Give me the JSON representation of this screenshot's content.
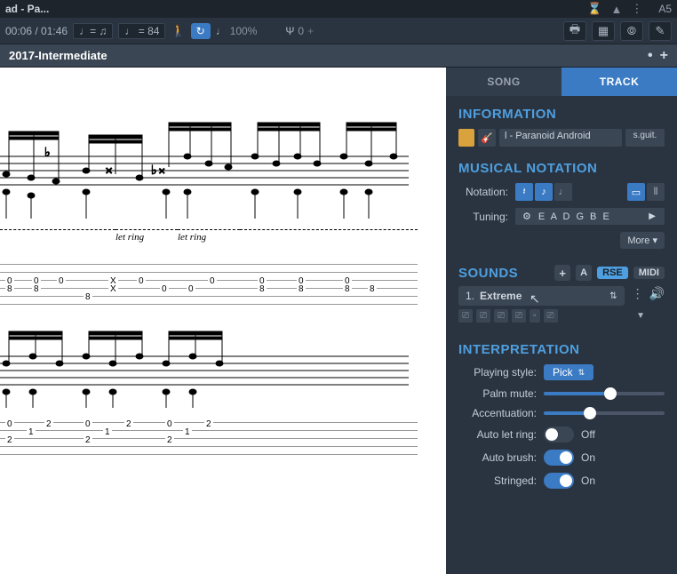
{
  "titlebar": {
    "title": "ad - Pa...",
    "right_badge": "A5"
  },
  "toolbar": {
    "time": "00:06 / 01:46",
    "tempo_sig": "♩= ♫",
    "tempo_bpm": "♩ = 84",
    "zoom": "100%",
    "countin": "0"
  },
  "score_title": "2017-Intermediate",
  "tabs": {
    "song": "SONG",
    "track": "TRACK"
  },
  "information": {
    "heading": "INFORMATION",
    "track_name": "l - Paranoid Android",
    "track_type": "s.guit."
  },
  "notation": {
    "heading": "MUSICAL NOTATION",
    "label": "Notation:",
    "tuning_label": "Tuning:",
    "tuning": "E A D G B E",
    "more": "More ▾"
  },
  "sounds": {
    "heading": "SOUNDS",
    "rse": "RSE",
    "midi": "MIDI",
    "selected_index": "1.",
    "selected_name": "Extreme"
  },
  "interpretation": {
    "heading": "INTERPRETATION",
    "playing_style_label": "Playing style:",
    "playing_style": "Pick",
    "palm_mute_label": "Palm mute:",
    "palm_mute_pct": 55,
    "accentuation_label": "Accentuation:",
    "accentuation_pct": 38,
    "auto_let_ring_label": "Auto let ring:",
    "auto_let_ring": false,
    "auto_let_ring_state": "Off",
    "auto_brush_label": "Auto brush:",
    "auto_brush": true,
    "auto_brush_state": "On",
    "stringed_label": "Stringed:",
    "stringed": true,
    "stringed_state": "On"
  },
  "score": {
    "let_ring": "let ring",
    "tab_row1": [
      "0",
      "0",
      "0",
      "X",
      "0",
      "0",
      "0",
      "0",
      "0"
    ],
    "tab_row2": [
      "8",
      "8",
      "X",
      "0",
      "0",
      "8",
      "8",
      "8",
      "8"
    ],
    "tab_row3_single": "8"
  }
}
